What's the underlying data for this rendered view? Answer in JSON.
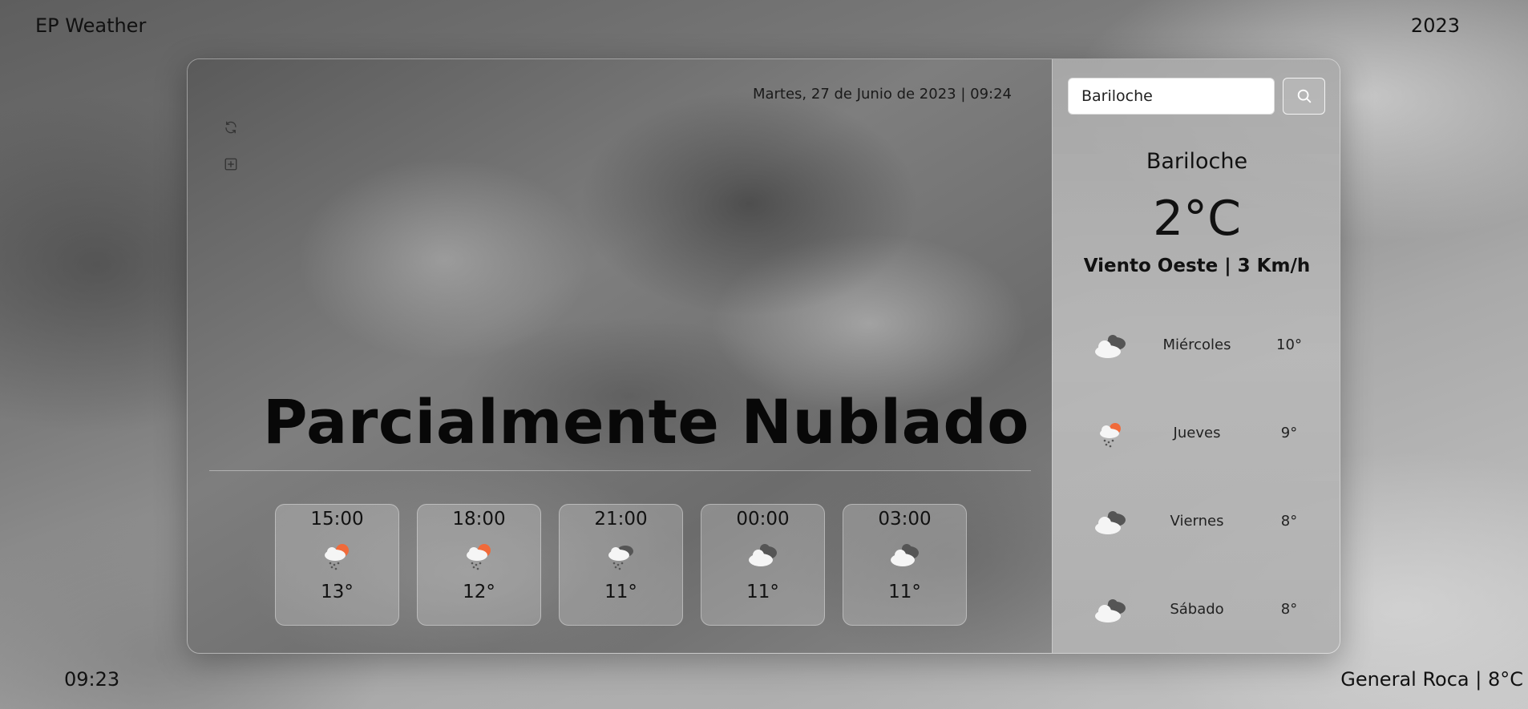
{
  "brand": "EP Weather",
  "year": "2023",
  "footer": {
    "clock": "09:23",
    "location_temp": "General Roca | 8°C"
  },
  "main": {
    "datetime": "Martes, 27 de Junio de 2023 | 09:24",
    "condition": "Parcialmente Nublado",
    "icons": {
      "refresh": "refresh-icon",
      "add": "add-square-icon"
    },
    "hourly": [
      {
        "time": "15:00",
        "temp": "13°",
        "icon": "rain-sun-icon"
      },
      {
        "time": "18:00",
        "temp": "12°",
        "icon": "rain-sun-icon"
      },
      {
        "time": "21:00",
        "temp": "11°",
        "icon": "rain-cloud-icon"
      },
      {
        "time": "00:00",
        "temp": "11°",
        "icon": "cloudy-icon"
      },
      {
        "time": "03:00",
        "temp": "11°",
        "icon": "cloudy-icon"
      }
    ]
  },
  "sidebar": {
    "search": {
      "value": "Bariloche",
      "icon": "search-icon"
    },
    "city": "Bariloche",
    "temp": "2°C",
    "wind": "Viento Oeste | 3 Km/h",
    "forecast": [
      {
        "day": "Miércoles",
        "temp": "10°",
        "icon": "cloudy-icon"
      },
      {
        "day": "Jueves",
        "temp": "9°",
        "icon": "rain-sun-icon"
      },
      {
        "day": "Viernes",
        "temp": "8°",
        "icon": "cloudy-icon"
      },
      {
        "day": "Sábado",
        "temp": "8°",
        "icon": "cloudy-icon"
      }
    ]
  },
  "colors": {
    "sun": "#f06a3a",
    "cloud_light": "#f5f5f5",
    "cloud_dark": "#555555"
  }
}
